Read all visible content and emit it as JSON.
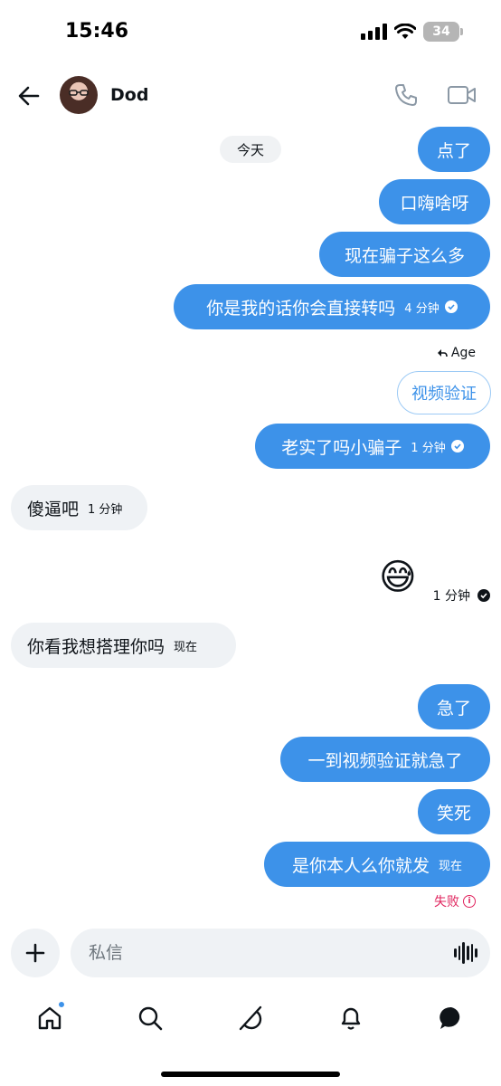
{
  "status_bar": {
    "time": "15:46",
    "battery": "34"
  },
  "header": {
    "contact_name": "Dod"
  },
  "chat": {
    "date_label": "今天",
    "messages_top": [
      {
        "text": "点了"
      },
      {
        "text": "口嗨啥呀"
      },
      {
        "text": "现在骗子这么多"
      },
      {
        "text": "你是我的话你会直接转吗",
        "time": "4 分钟"
      }
    ],
    "reply_label": "Age",
    "reply_button": "视频验证",
    "message_after_reply": {
      "text": "老实了吗小骗子",
      "time": "1 分钟"
    },
    "incoming_1": {
      "text": "傻逼吧",
      "time": "1 分钟"
    },
    "emoji_message": {
      "emoji": "😅",
      "time": "1 分钟"
    },
    "incoming_2": {
      "text": "你看我想搭理你吗",
      "time": "现在"
    },
    "messages_bottom": [
      {
        "text": "急了"
      },
      {
        "text": "一到视频验证就急了"
      },
      {
        "text": "笑死"
      },
      {
        "text": "是你本人么你就发",
        "time": "现在"
      }
    ],
    "failed_label": "失败"
  },
  "composer": {
    "placeholder": "私信"
  },
  "colors": {
    "accent": "#3d92e9",
    "incoming_bg": "#eff2f5",
    "error": "#e0245e"
  },
  "icons": [
    "back-arrow-icon",
    "phone-icon",
    "video-camera-icon",
    "check-circle-icon",
    "reply-arrow-icon",
    "plus-icon",
    "voice-wave-icon",
    "home-icon",
    "search-icon",
    "grok-icon",
    "bell-icon",
    "messages-icon",
    "error-icon"
  ]
}
